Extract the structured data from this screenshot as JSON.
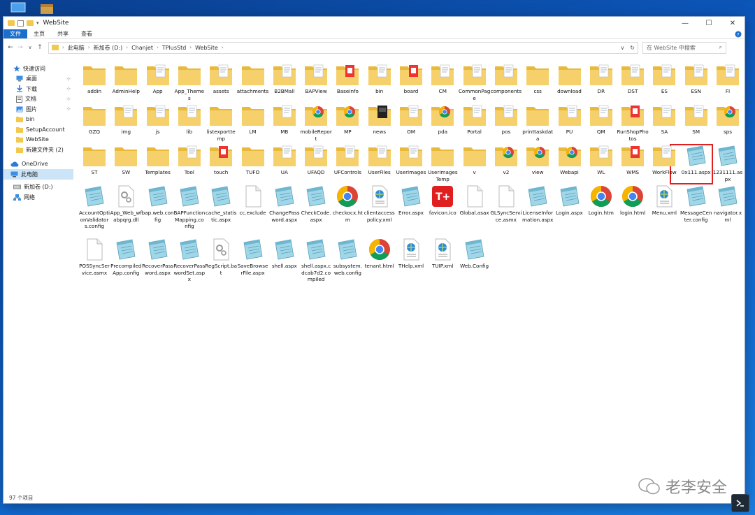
{
  "window": {
    "title": "WebSite"
  },
  "ribbon": {
    "tabs": [
      "文件",
      "主页",
      "共享",
      "查看"
    ]
  },
  "address": {
    "crumbs": [
      "此电脑",
      "新加卷 (D:)",
      "Chanjet",
      "TPlusStd",
      "WebSite"
    ]
  },
  "search": {
    "placeholder": "在 WebSite 中搜索"
  },
  "nav": {
    "items": [
      {
        "label": "快速访问",
        "icon": "star-icon"
      },
      {
        "label": "桌面",
        "icon": "desktop-icon",
        "pinned": true
      },
      {
        "label": "下载",
        "icon": "download-icon",
        "pinned": true
      },
      {
        "label": "文档",
        "icon": "document-icon",
        "pinned": true
      },
      {
        "label": "图片",
        "icon": "picture-icon",
        "pinned": true
      },
      {
        "label": "bin",
        "icon": "folder-icon"
      },
      {
        "label": "SetupAccount",
        "icon": "folder-icon"
      },
      {
        "label": "WebSite",
        "icon": "folder-icon"
      },
      {
        "label": "新建文件夹 (2)",
        "icon": "folder-icon"
      },
      {
        "label": "OneDrive",
        "icon": "cloud-icon"
      },
      {
        "label": "此电脑",
        "icon": "computer-icon",
        "selected": true
      },
      {
        "label": "新加卷 (D:)",
        "icon": "drive-icon"
      },
      {
        "label": "网络",
        "icon": "network-icon"
      }
    ]
  },
  "files": [
    [
      "addin",
      "folder"
    ],
    [
      "AdminHelp",
      "folder"
    ],
    [
      "App",
      "folder-doc"
    ],
    [
      "App_Themes",
      "folder"
    ],
    [
      "assets",
      "folder-doc"
    ],
    [
      "attachments",
      "folder"
    ],
    [
      "B2BMall",
      "folder-doc"
    ],
    [
      "BAPView",
      "folder-doc"
    ],
    [
      "BaseInfo",
      "folder-red"
    ],
    [
      "bin",
      "folder-doc"
    ],
    [
      "board",
      "folder-red"
    ],
    [
      "CM",
      "folder-doc"
    ],
    [
      "CommonPage",
      "folder-doc"
    ],
    [
      "components",
      "folder-doc"
    ],
    [
      "css",
      "folder"
    ],
    [
      "download",
      "folder"
    ],
    [
      "DR",
      "folder-doc"
    ],
    [
      "DST",
      "folder-doc"
    ],
    [
      "ES",
      "folder-doc"
    ],
    [
      "ESN",
      "folder-doc"
    ],
    [
      "FI",
      "folder-doc"
    ],
    [
      "GZQ",
      "folder"
    ],
    [
      "img",
      "folder-doc"
    ],
    [
      "js",
      "folder-doc"
    ],
    [
      "lib",
      "folder-doc"
    ],
    [
      "listexporttemp",
      "folder"
    ],
    [
      "LM",
      "folder"
    ],
    [
      "MB",
      "folder-doc"
    ],
    [
      "mobileReport",
      "folder-chrome"
    ],
    [
      "MP",
      "folder-chrome"
    ],
    [
      "news",
      "folder-dark"
    ],
    [
      "OM",
      "folder-doc"
    ],
    [
      "pda",
      "folder-chrome"
    ],
    [
      "Portal",
      "folder-doc"
    ],
    [
      "pos",
      "folder-doc"
    ],
    [
      "printtaskdata",
      "folder"
    ],
    [
      "PU",
      "folder-doc"
    ],
    [
      "QM",
      "folder-doc"
    ],
    [
      "RunShopPhotos",
      "folder-red"
    ],
    [
      "SA",
      "folder-doc"
    ],
    [
      "SM",
      "folder-doc"
    ],
    [
      "sps",
      "folder-chrome"
    ],
    [
      "ST",
      "folder"
    ],
    [
      "SW",
      "folder"
    ],
    [
      "Templates",
      "folder"
    ],
    [
      "Tool",
      "folder-doc"
    ],
    [
      "touch",
      "folder-red"
    ],
    [
      "TUFO",
      "folder"
    ],
    [
      "UA",
      "folder-doc"
    ],
    [
      "UFAQD",
      "folder-doc"
    ],
    [
      "UFControls",
      "folder-doc"
    ],
    [
      "UserFiles",
      "folder-doc"
    ],
    [
      "UserImages",
      "folder-doc"
    ],
    [
      "UserImagesTemp",
      "folder"
    ],
    [
      "v",
      "folder"
    ],
    [
      "v2",
      "folder-chrome"
    ],
    [
      "view",
      "folder-chrome"
    ],
    [
      "Webapi",
      "folder-chrome"
    ],
    [
      "WL",
      "folder-doc"
    ],
    [
      "WMS",
      "folder-red"
    ],
    [
      "WorkFlow",
      "folder-doc"
    ],
    [
      "0x111.aspx",
      "notepad"
    ],
    [
      "1231111.aspx",
      "notepad"
    ],
    [
      "AccountOptionValidators.config",
      "notepad"
    ],
    [
      "App_Web_wfabpqrg.dll",
      "gear"
    ],
    [
      "bap.web.config",
      "notepad"
    ],
    [
      "BAPFunctionMapping.config",
      "notepad"
    ],
    [
      "cache_statistic.aspx",
      "notepad"
    ],
    [
      "cc.exclude",
      "blank"
    ],
    [
      "ChangePassword.aspx",
      "notepad"
    ],
    [
      "CheckCode.aspx",
      "notepad"
    ],
    [
      "checkocx.htm",
      "chrome"
    ],
    [
      "clientaccesspolicy.xml",
      "xml"
    ],
    [
      "Error.aspx",
      "notepad"
    ],
    [
      "favicon.ico",
      "favicon"
    ],
    [
      "Global.asax",
      "blank"
    ],
    [
      "GLSyncService.asmx",
      "blank"
    ],
    [
      "LicenseInformation.aspx",
      "notepad"
    ],
    [
      "Login.aspx",
      "notepad"
    ],
    [
      "Login.htm",
      "chrome"
    ],
    [
      "login.html",
      "chrome"
    ],
    [
      "Menu.xml",
      "xml"
    ],
    [
      "MessageCenter.config",
      "notepad"
    ],
    [
      "navigator.xml",
      "notepad"
    ],
    [
      "POSSyncService.asmx",
      "blank"
    ],
    [
      "PrecompiledApp.config",
      "notepad"
    ],
    [
      "RecoverPassword.aspx",
      "notepad"
    ],
    [
      "RecoverPasswordSet.aspx",
      "notepad"
    ],
    [
      "RegScript.bat",
      "gear"
    ],
    [
      "SaveBrowserFile.aspx",
      "notepad"
    ],
    [
      "shell.aspx",
      "notepad"
    ],
    [
      "shell.aspx.cdcab7d2.compiled",
      "notepad"
    ],
    [
      "subsystem.web.config",
      "notepad"
    ],
    [
      "tenant.html",
      "chrome"
    ],
    [
      "THelp.xml",
      "xml"
    ],
    [
      "TUIP.xml",
      "xml"
    ],
    [
      "Web.Config",
      "notepad"
    ]
  ],
  "status": {
    "count": "97 个项目"
  },
  "watermark": {
    "text": "老李安全"
  },
  "colors": {
    "folder": "#f2c94c",
    "accent": "#1a6fcc",
    "highlight": "#e02020"
  }
}
